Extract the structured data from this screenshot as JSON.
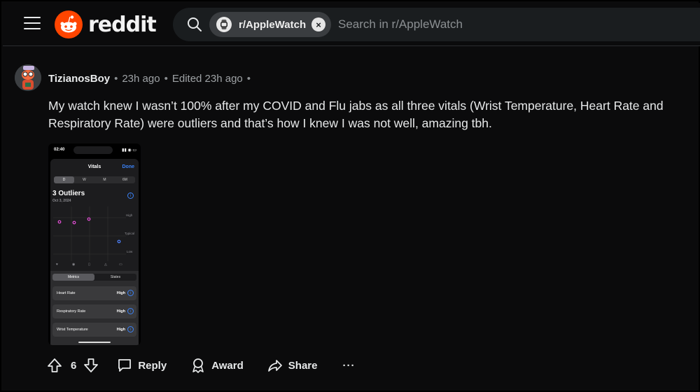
{
  "header": {
    "logo_text": "reddit",
    "community_chip": "r/AppleWatch",
    "chip_close_glyph": "×",
    "search_placeholder": "Search in r/AppleWatch"
  },
  "comment": {
    "author": "TizianosBoy",
    "time": "23h ago",
    "edited": "Edited 23h ago",
    "separator": "•",
    "body": "My watch knew I wasn’t 100% after my COVID and Flu jabs as all three vitals (Wrist Temperature, Heart Rate and Respiratory Rate) were outliers and that’s how I knew I was not well, amazing tbh."
  },
  "embedded_screenshot": {
    "status_time": "02:40",
    "title": "Vitals",
    "done": "Done",
    "ranges": [
      "D",
      "W",
      "M",
      "6M"
    ],
    "selected_range": "D",
    "heading": "3 Outliers",
    "date": "Oct 3, 2024",
    "levels": [
      "High",
      "Typical",
      "Low"
    ],
    "tabs": [
      "Metrics",
      "States"
    ],
    "selected_tab": "Metrics",
    "metrics": [
      {
        "name": "Heart Rate",
        "value": "High"
      },
      {
        "name": "Respiratory Rate",
        "value": "High"
      },
      {
        "name": "Wrist Temperature",
        "value": "High"
      }
    ]
  },
  "actions": {
    "vote_count": "6",
    "reply": "Reply",
    "award": "Award",
    "share": "Share",
    "more": "···"
  },
  "colors": {
    "background": "#0b0b0c",
    "brand": "#ff4500",
    "outlier_pink": "#e34fd6",
    "outlier_blue": "#4f83ff",
    "link_blue": "#3b82f6"
  }
}
